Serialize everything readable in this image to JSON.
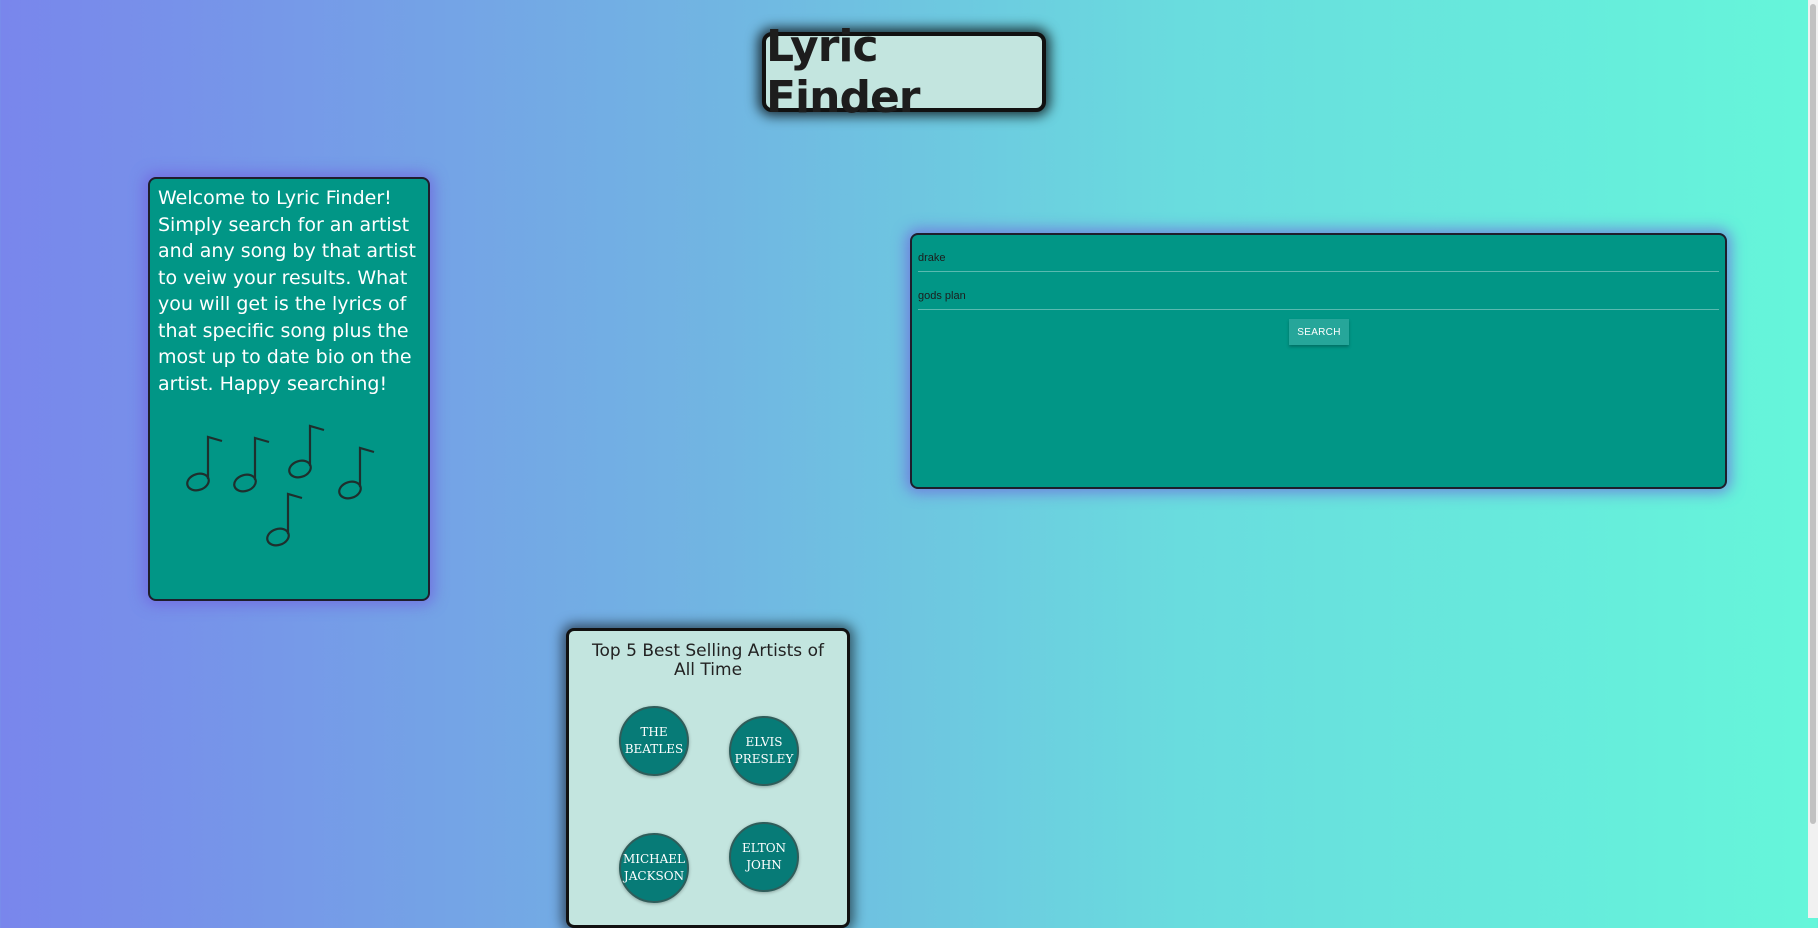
{
  "header": {
    "title": "Lyric Finder"
  },
  "welcome": {
    "text": "Welcome to Lyric Finder! Simply search for an artist and any song by that artist to veiw your results. What you will get is the lyrics of that specific song plus the most up to date bio on the artist. Happy searching!"
  },
  "search": {
    "artist_value": "drake",
    "song_value": "gods plan",
    "button_label": "SEARCH"
  },
  "top_artists": {
    "title": "Top 5 Best Selling Artists of All Time",
    "artists": [
      "THE BEATLES",
      "ELVIS PRESLEY",
      "MICHAEL JACKSON",
      "ELTON JOHN"
    ]
  },
  "colors": {
    "card_teal": "#019686",
    "title_bg": "#c3e5df",
    "gradient_left": "#7986ec",
    "gradient_right": "#65f6da",
    "artist_circle": "#077b77"
  },
  "icons": [
    "music-note-icon"
  ]
}
